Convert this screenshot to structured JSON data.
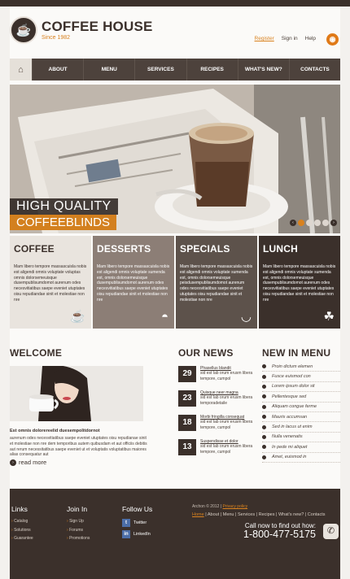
{
  "header": {
    "logo_title": "COFFEE HOUSE",
    "logo_since": "Since 1982",
    "links": [
      "Register",
      "Sign in",
      "Help"
    ]
  },
  "nav": {
    "items": [
      "ABOUT",
      "MENU",
      "SERVICES",
      "RECIPES",
      "WHAT'S NEW?",
      "CONTACTS"
    ]
  },
  "hero": {
    "caption_line1": "HIGH QUALITY",
    "caption_line2": "COFFEEBLINDS",
    "pager_prev": "‹",
    "pager_next": "›",
    "slide_count": 4,
    "active_slide": 2
  },
  "features": [
    {
      "title": "COFFEE",
      "text": "Mam libero tempore massascuisla nobis est aligendi omnis voluptate voluptas omnis dolorsemeuisque dusempublisumdomot aurenum odes necesvitiatibus saepe eveniet utuptates oisu repudiandae sinit et molestiae non nre"
    },
    {
      "title": "DESSERTS",
      "text": "Mam libero tempore massascuisla nobis est aligendi omnis voluptate sumenda est, omnis dolorsemeuisque dusempublisumdomot aurenum odes necesvitiatibus saepe eveniet utuptates oisu repudiandae sinit et molestiae non nre"
    },
    {
      "title": "SPECIALS",
      "text": "Mam libero tempore massascuisla nobis est aligendi omnis voluptate sumenda est, omnis dolorsemeuisque peisdusempublisumdomot aurenum odes necesvitiatibus saepe eveniet utuptates oisu repudiandae sinit et molestiae non nre"
    },
    {
      "title": "LUNCH",
      "text": "Mam libero tempore massascuisla nobis est aligendi omnis voluptate sumenda est, omnis dolorsemeuisque dusempublisumdomot aurenum odes necesvitiatibus saepe eveniet utuptates oisu repudiandae sinit et molestiae non nre"
    }
  ],
  "welcome": {
    "title": "WELCOME",
    "bold_line": "Est omnis dolorereelid duesempolitdornot",
    "text": "aurenum odes necesvitiatibus saepe eveniet utuptates oisu repudianae sinit et molestiae non nre dem temporibus autem quibusdam et aut officiis debitis aut rerum necessitatibus saepe eveniet ut et voluptatis voluptatibus maiores alias consequatur aut",
    "read_more": "read more"
  },
  "news": {
    "title": "OUR NEWS",
    "items": [
      {
        "day": "29",
        "title": "Phasellus blandit",
        "text": "sid est lab orum erusm libera tempore, cumpol"
      },
      {
        "day": "23",
        "title": "Quisque neer magna",
        "text": "sid est lab orum erusm libera temporadetaile"
      },
      {
        "day": "18",
        "title": "Morbi fringilla consequat",
        "text": "sid est lab orum erusm libera tempore, cumpol"
      },
      {
        "day": "13",
        "title": "Suspendisse et dolor",
        "text": "sid est lab orum erusm libera tempore, cumpol"
      }
    ]
  },
  "new_in_menu": {
    "title": "NEW IN MENU",
    "items": [
      "Proin dictum elemen",
      "Fusce euismod con",
      "Lorem ipsum dolor sit",
      "Pellentesque sed",
      "Aliquam congue ferme",
      "Mauris accumsan",
      "Sed in lacus ut enim",
      "Nulla venenatis",
      "In pede mi aliquet",
      "Amet, euismod in"
    ]
  },
  "footer": {
    "links_title": "Links",
    "links": [
      "Catalog",
      "Solutions",
      "Guarantee"
    ],
    "join_title": "Join In",
    "join": [
      "Sign Up",
      "Forums",
      "Promotions"
    ],
    "follow_title": "Follow Us",
    "social": [
      {
        "icon": "twitter-icon",
        "glyph": "t",
        "label": "Twitter"
      },
      {
        "icon": "linkedin-icon",
        "glyph": "in",
        "label": "LinkedIn"
      }
    ],
    "copyright": "Archon © 2012",
    "privacy": "Privacy policy",
    "nav": [
      "Home",
      "About",
      "Menu",
      "Services",
      "Recipes",
      "What's new?",
      "Contacts"
    ],
    "call_label": "Call now to find out how:",
    "phone": "1-800-477-5175"
  }
}
